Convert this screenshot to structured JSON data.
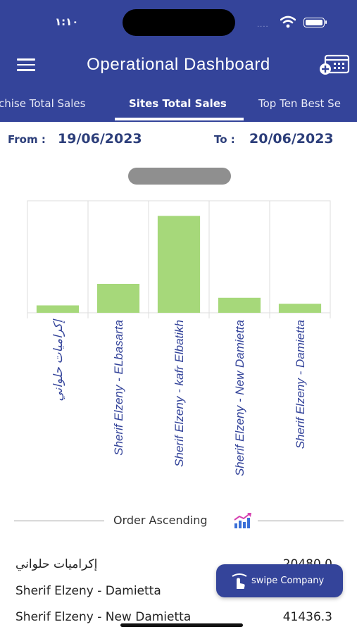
{
  "status_bar": {
    "time": "١:١٠",
    "signal": "....",
    "wifi_icon": "wifi-icon",
    "battery_icon": "battery-icon"
  },
  "header": {
    "title": "Operational Dashboard",
    "menu_icon": "hamburger-menu-icon",
    "calendar_icon": "calendar-add-icon",
    "bg_color": "#34449a"
  },
  "tabs": [
    {
      "label": "Franchise Total Sales",
      "visible_text": "chise Total Sales",
      "active": false
    },
    {
      "label": "Sites Total Sales",
      "visible_text": "Sites Total Sales",
      "active": true
    },
    {
      "label": "Top Ten Best Se",
      "visible_text": "Top Ten Best Se",
      "active": false
    }
  ],
  "date_range": {
    "from_label": "From :",
    "from_value": "19/06/2023",
    "to_label": "To :",
    "to_value": "20/06/2023"
  },
  "chart_data": {
    "type": "bar",
    "categories": [
      "إكراميات حلواني",
      "Sherif Elzeny - ELbasarta",
      "Sherif Elzeny - kafr Elbatikh",
      "Sherif Elzeny - New Damietta",
      "Sherif Elzeny - Damietta"
    ],
    "values": [
      20480,
      80000,
      268000,
      41436.3,
      25000
    ],
    "ylim": [
      0,
      310000
    ],
    "grid": true,
    "bar_color": "#a6d87a",
    "label_color": "#34449a"
  },
  "sort": {
    "label": "Order Ascending",
    "icon": "sort-ascending-chart-icon"
  },
  "list": [
    {
      "name": "إكراميات حلواني",
      "value": "20480.0"
    },
    {
      "name": "Sherif Elzeny - Damietta",
      "value": ""
    },
    {
      "name": "Sherif Elzeny - New Damietta",
      "value": "41436.3"
    }
  ],
  "swipe_button": {
    "label": "swipe Company",
    "icon": "touch-swipe-icon"
  }
}
